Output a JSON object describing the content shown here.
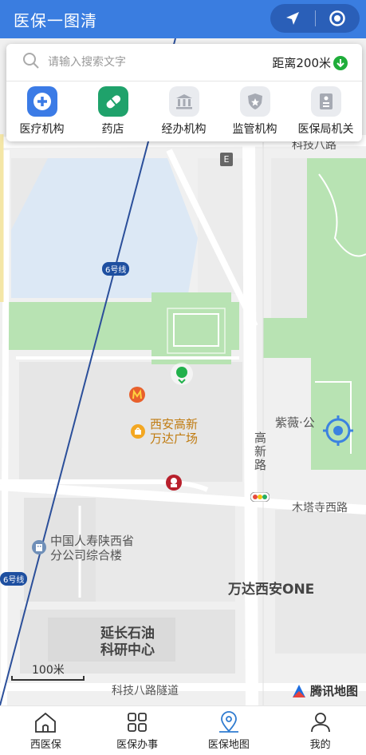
{
  "header": {
    "title": "医保一图清",
    "capsule": {
      "left_icon": "navigation-arrow-icon",
      "right_icon": "record-circle-icon"
    }
  },
  "search": {
    "placeholder": "请输入搜索文字",
    "distance_label": "距离200米",
    "distance_icon": "down-arrow-icon"
  },
  "categories": [
    {
      "label": "医疗机构",
      "icon": "medical-plus-icon",
      "color": "#3b7be6",
      "active": true
    },
    {
      "label": "药店",
      "icon": "pill-icon",
      "color": "#1fa26b",
      "active": true
    },
    {
      "label": "经办机构",
      "icon": "bank-building-icon",
      "color": "#a6aab3",
      "active": false
    },
    {
      "label": "监管机构",
      "icon": "shield-star-icon",
      "color": "#a6aab3",
      "active": false
    },
    {
      "label": "医保局机关",
      "icon": "id-card-icon",
      "color": "#a6aab3",
      "active": false
    }
  ],
  "map": {
    "roads": {
      "keji8": "科技八路",
      "muta_temple": "木塔寺西路",
      "gaoxin": "高新路",
      "tunnel": "科技八路隧道"
    },
    "metro_label": "6号线",
    "highway_badge": "E",
    "pois": {
      "ziwei": "紫薇·公",
      "wanda_plaza": "西安高新万达广场",
      "china_life": "中国人寿陕西省分公司综合楼",
      "wanda_one": "万达西安ONE",
      "yanchang": "延长石油科研中心"
    },
    "scale_label": "100米",
    "provider": "腾讯地图"
  },
  "nav": [
    {
      "label": "西医保",
      "icon": "home-icon",
      "active": false
    },
    {
      "label": "医保办事",
      "icon": "grid-icon",
      "active": false
    },
    {
      "label": "医保地图",
      "icon": "map-pin-icon",
      "active": true
    },
    {
      "label": "我的",
      "icon": "user-icon",
      "active": false
    }
  ],
  "colors": {
    "header": "#3a7de0",
    "accent_active": "#2f7bd0",
    "park": "#b8e3b3",
    "water": "#dce8f5"
  }
}
